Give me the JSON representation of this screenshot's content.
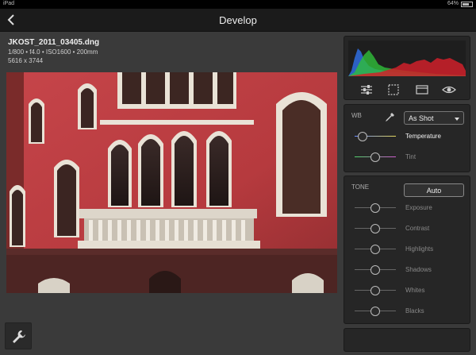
{
  "status": {
    "carrier": "iPad",
    "time": "",
    "battery": "64%"
  },
  "nav": {
    "title": "Develop",
    "back_icon": "chevron-left-icon"
  },
  "image_info": {
    "filename": "JKOST_2011_03405.dng",
    "exposure": "1/800 • f4.0 • ISO1600 • 200mm",
    "dimensions": "5616 x 3744"
  },
  "histogram": {
    "colors": {
      "blue": "#2f6de0",
      "green": "#2fbf3a",
      "red": "#d0202a"
    }
  },
  "mode_icons": [
    "sliders-icon",
    "crop-icon",
    "presets-icon",
    "eye-icon"
  ],
  "wb": {
    "label": "WB",
    "eyedropper_icon": "eyedropper-icon",
    "preset": "As Shot",
    "sliders": [
      {
        "label": "Temperature",
        "value": 0.2,
        "active": true
      },
      {
        "label": "Tint",
        "value": 0.5,
        "active": false
      }
    ]
  },
  "tone": {
    "label": "TONE",
    "auto_label": "Auto",
    "sliders": [
      {
        "label": "Exposure",
        "value": 0.5
      },
      {
        "label": "Contrast",
        "value": 0.5
      },
      {
        "label": "Highlights",
        "value": 0.5
      },
      {
        "label": "Shadows",
        "value": 0.5
      },
      {
        "label": "Whites",
        "value": 0.5
      },
      {
        "label": "Blacks",
        "value": 0.5
      }
    ]
  },
  "tools": {
    "wrench_icon": "wrench-icon"
  }
}
